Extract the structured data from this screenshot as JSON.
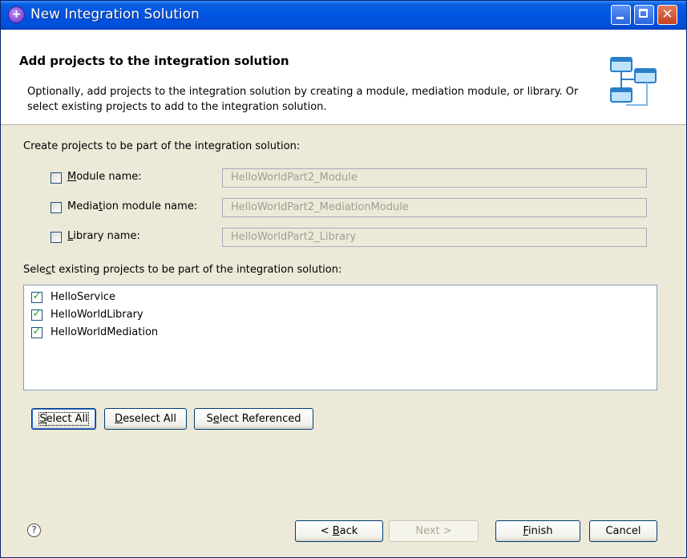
{
  "window": {
    "title": "New Integration Solution",
    "close_glyph": "✕",
    "app_icon_glyph": "+"
  },
  "header": {
    "title": "Add projects to the integration solution",
    "description": "Optionally, add projects to the integration solution by creating a module, mediation module, or library. Or select existing projects to add to the integration solution."
  },
  "create_section": {
    "label": "Create projects to be part of the integration solution:",
    "module": {
      "label_first": "M",
      "label_rest": "odule name:",
      "checked": false,
      "value": "HelloWorldPart2_Module"
    },
    "mediation": {
      "label_pre": "Media",
      "label_u": "t",
      "label_post": "ion module name:",
      "checked": false,
      "value": "HelloWorldPart2_MediationModule"
    },
    "library": {
      "label_first": "L",
      "label_rest": "ibrary name:",
      "checked": false,
      "value": "HelloWorldPart2_Library"
    }
  },
  "existing_section": {
    "label_pre": "Sele",
    "label_u": "c",
    "label_post": "t existing projects to be part of the integration solution:",
    "tick_glyph": "✓",
    "items": [
      {
        "label": "HelloService",
        "checked": true
      },
      {
        "label": "HelloWorldLibrary",
        "checked": true
      },
      {
        "label": "HelloWorldMediation",
        "checked": true
      }
    ]
  },
  "selection_buttons": {
    "select_all": {
      "u": "S",
      "rest": "elect All"
    },
    "deselect_all": {
      "u": "D",
      "rest": "eselect All"
    },
    "select_referenced": {
      "pre": "S",
      "u": "e",
      "rest": "lect Referenced"
    }
  },
  "footer": {
    "help_glyph": "?",
    "back": {
      "pre": "< ",
      "u": "B",
      "rest": "ack"
    },
    "next": {
      "label": "Next >",
      "enabled": false
    },
    "finish": {
      "u": "F",
      "rest": "inish"
    },
    "cancel": {
      "label": "Cancel"
    }
  }
}
